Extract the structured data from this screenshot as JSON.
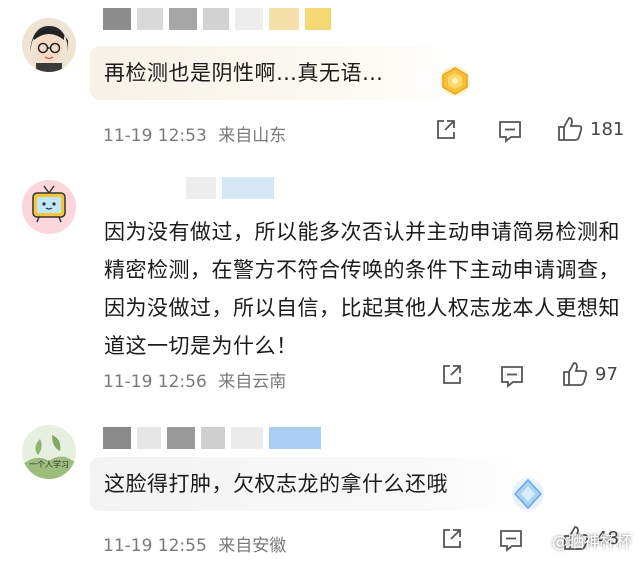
{
  "comments": [
    {
      "text": "再检测也是阴性啊…真无语…",
      "time": "11-19 12:53",
      "location": "来自山东",
      "likes": "181"
    },
    {
      "text": "因为没有做过，所以能多次否认并主动申请简易检测和精密检测，在警方不符合传唤的条件下主动申请调查，因为没做过，所以自信，比起其他人权志龙本人更想知道这一切是为什么！",
      "time": "11-19 12:56",
      "location": "来自云南",
      "likes": "97"
    },
    {
      "text": "这脸得打肿，欠权志龙的拿什么还哦",
      "time": "11-19 12:55",
      "location": "来自安徽",
      "likes": "48"
    }
  ],
  "avatar3_text": "一个人学习",
  "watermark": "@晒神杯杯",
  "icons": [
    "share-icon",
    "comment-icon",
    "like-icon",
    "vip-badge-icon"
  ],
  "colors": {
    "meta": "#7a7a7a",
    "badge_gold": "#f2b92e",
    "badge_blue": "#7fb6ea"
  }
}
